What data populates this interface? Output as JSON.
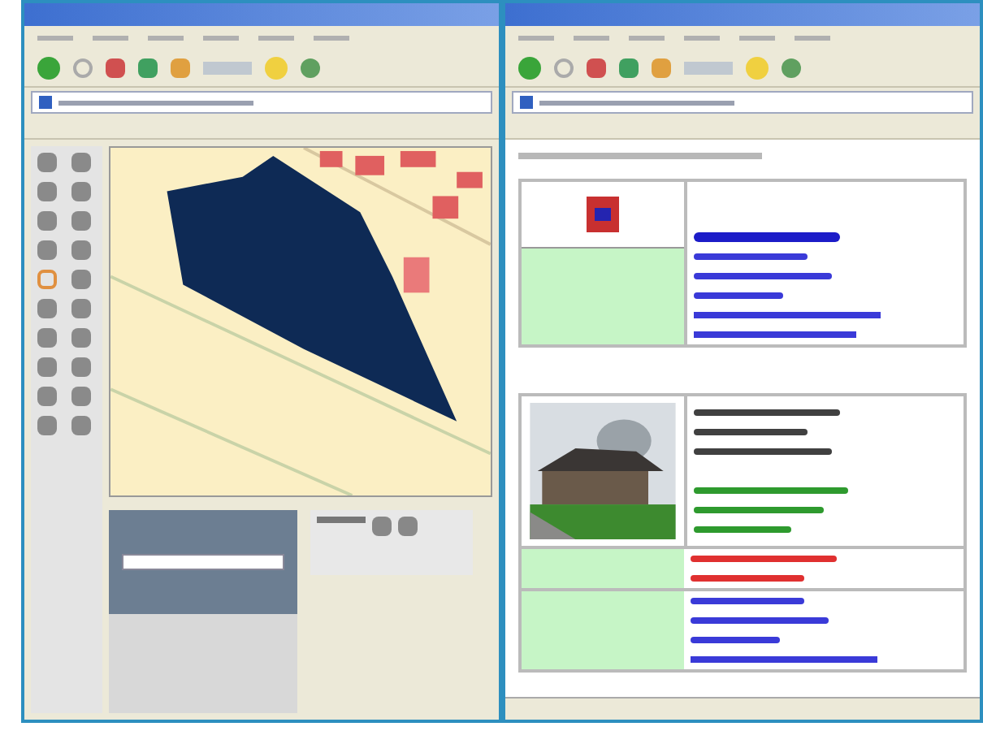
{
  "contact_card": {
    "lines": [
      {
        "kind": "heading",
        "color": "#1c1cc8"
      },
      {
        "kind": "text",
        "color": "#3a3ad8"
      },
      {
        "kind": "text",
        "color": "#3a3ad8"
      },
      {
        "kind": "text",
        "color": "#3a3ad8"
      },
      {
        "kind": "link",
        "color": "#3a3ad8"
      },
      {
        "kind": "link",
        "color": "#3a3ad8"
      }
    ]
  },
  "property_card": {
    "lines": [
      {
        "kind": "text",
        "color": "#404040"
      },
      {
        "kind": "text",
        "color": "#404040"
      },
      {
        "kind": "text",
        "color": "#404040"
      },
      {
        "kind": "gap",
        "color": "#ffffff"
      },
      {
        "kind": "text",
        "color": "#2e9a2e"
      },
      {
        "kind": "text",
        "color": "#2e9a2e"
      },
      {
        "kind": "text",
        "color": "#2e9a2e"
      }
    ],
    "rows": [
      {
        "lines": [
          {
            "kind": "text",
            "color": "#e03030"
          },
          {
            "kind": "text",
            "color": "#e03030"
          }
        ]
      },
      {
        "lines": [
          {
            "kind": "text",
            "color": "#3a3ad8"
          },
          {
            "kind": "text",
            "color": "#3a3ad8"
          },
          {
            "kind": "text",
            "color": "#3a3ad8"
          },
          {
            "kind": "link",
            "color": "#3a3ad8"
          }
        ]
      }
    ]
  }
}
